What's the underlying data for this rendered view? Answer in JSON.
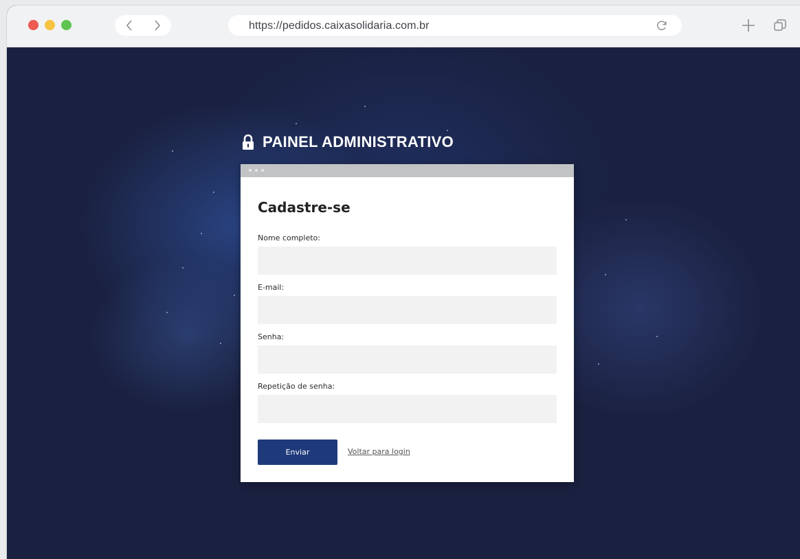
{
  "browser": {
    "url": "https://pedidos.caixasolidaria.com.br",
    "icons": {
      "back": "chevron-left-icon",
      "forward": "chevron-right-icon",
      "reload": "reload-icon",
      "new_tab": "plus-icon",
      "tabs": "tabs-icon"
    },
    "traffic_lights": [
      "#ed5a52",
      "#f6c342",
      "#5fc451"
    ]
  },
  "page": {
    "heading": "PAINEL ADMINISTRATIVO",
    "heading_icon": "lock-icon",
    "background_color": "#1a2140"
  },
  "form": {
    "title": "Cadastre-se",
    "fields": [
      {
        "label": "Nome completo:",
        "value": ""
      },
      {
        "label": "E-mail:",
        "value": ""
      },
      {
        "label": "Senha:",
        "value": ""
      },
      {
        "label": "Repetição de senha:",
        "value": ""
      }
    ],
    "submit_label": "Enviar",
    "back_link": "Voltar para login",
    "accent_color": "#1e3a7b"
  }
}
